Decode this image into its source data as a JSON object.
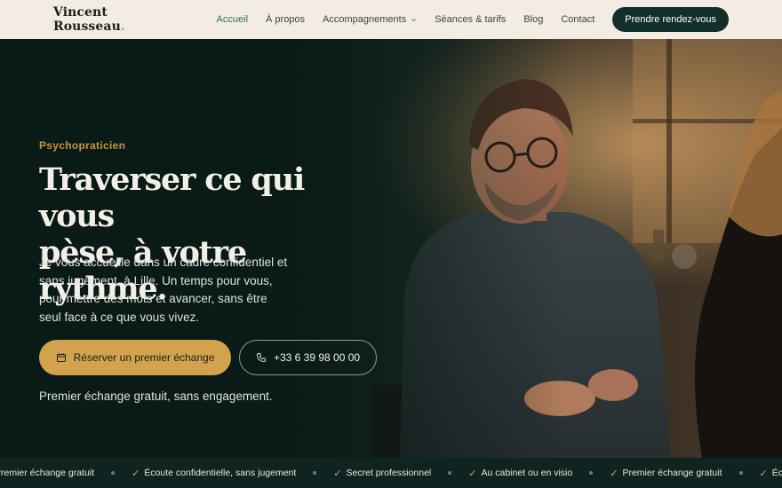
{
  "header": {
    "brand": "Vincent Rousseau",
    "brand_dot": ".",
    "nav": [
      {
        "label": "Accueil",
        "active": true
      },
      {
        "label": "À propos"
      },
      {
        "label": "Accompagnements",
        "dropdown": true
      },
      {
        "label": "Séances & tarifs"
      },
      {
        "label": "Blog"
      },
      {
        "label": "Contact"
      }
    ],
    "cta": "Prendre rendez-vous"
  },
  "hero": {
    "eyebrow": "Psychopraticien",
    "headline_line1": "Traverser ce qui vous",
    "headline_line2": "pèse, à votre rythme.",
    "lead": "Je vous accueille dans un cadre confidentiel et sans jugement, à Lille. Un temps pour vous, pour mettre des mots et avancer, sans être seul face à ce que vous vivez.",
    "primary_button": "Réserver un premier échange",
    "primary_icon": "calendar-icon",
    "secondary_button": "+33 6 39 98 00 00",
    "secondary_icon": "phone-icon",
    "note": "Premier échange gratuit, sans engagement."
  },
  "ticker": {
    "items": [
      "Premier échange gratuit",
      "Écoute confidentielle, sans jugement",
      "Secret professionnel",
      "Au cabinet ou en visio",
      "Premier échange gratuit",
      "Écoute confidentielle, sans jugement"
    ],
    "check_mark": "✓"
  },
  "colors": {
    "accent": "#d3a24f",
    "dark": "#12302a",
    "header_bg": "#f3ece2"
  }
}
